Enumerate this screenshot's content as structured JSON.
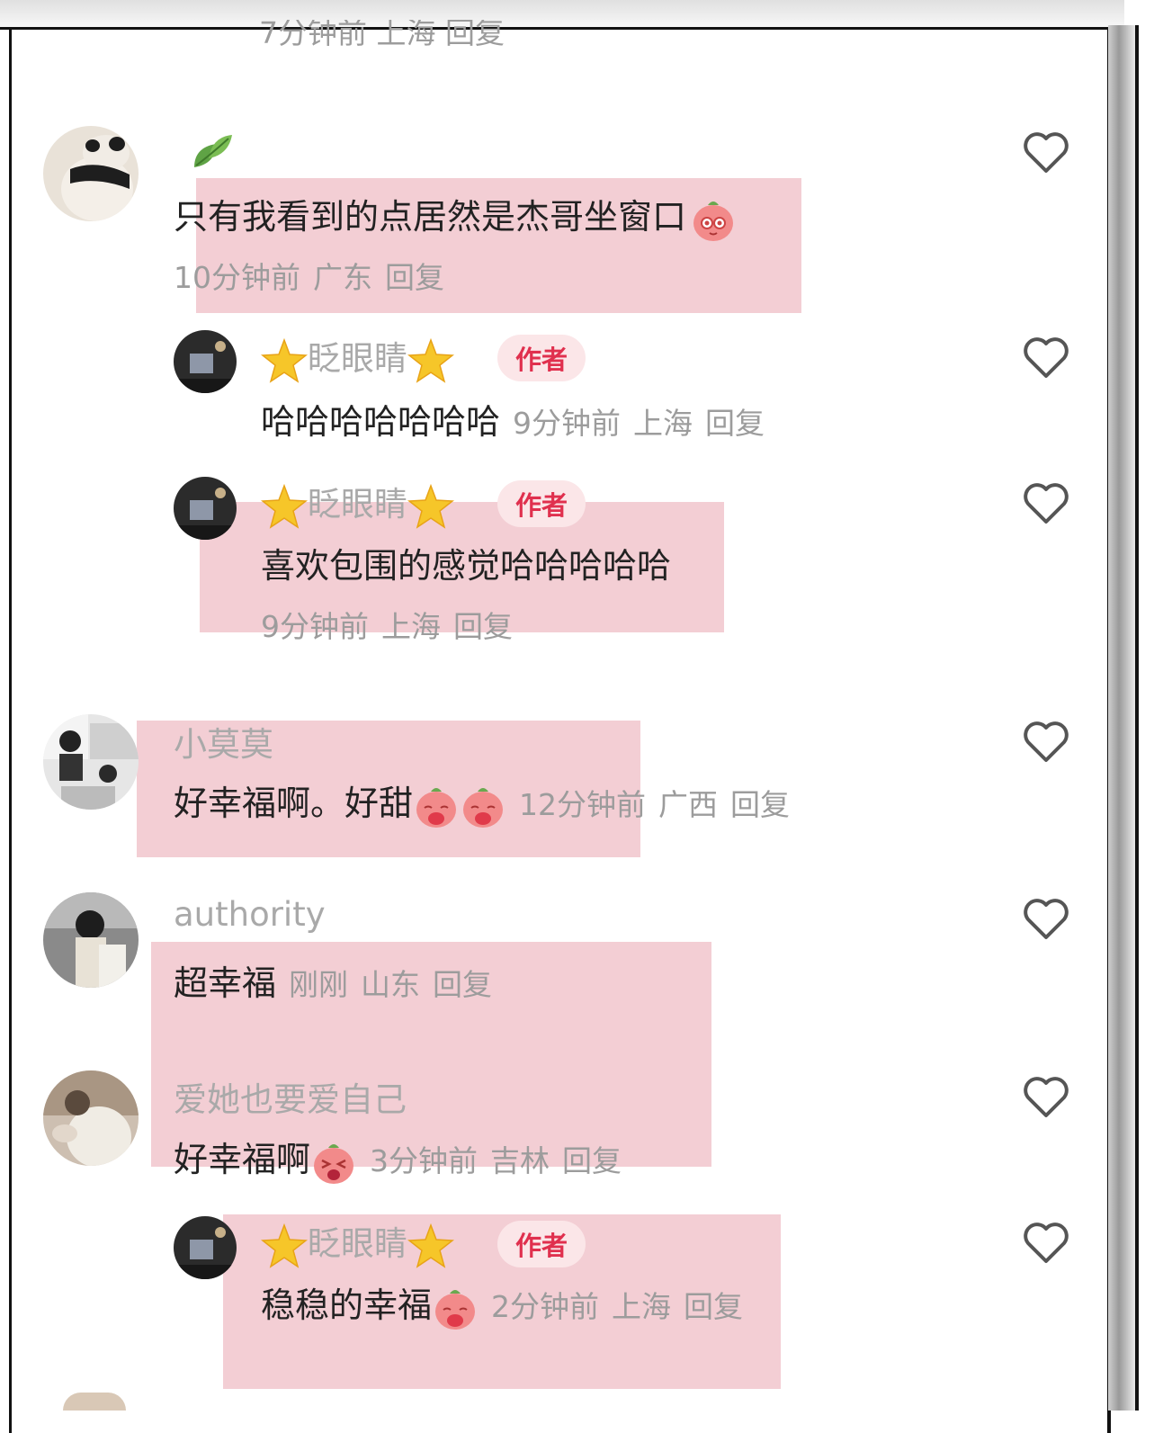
{
  "top_partial_meta": "7分钟前 上海 回复",
  "author_badge": "作者",
  "comments": [
    {
      "name": "",
      "text": "只有我看到的点居然是杰哥坐窗口",
      "time": "10分钟前",
      "location": "广东",
      "reply": "回复",
      "avatar": "panda-avatar"
    },
    {
      "name": "眨眼睛",
      "text": "哈哈哈哈哈哈哈",
      "time": "9分钟前",
      "location": "上海",
      "reply": "回复",
      "is_author": true
    },
    {
      "name": "眨眼睛",
      "text": "喜欢包围的感觉哈哈哈哈哈",
      "time": "9分钟前",
      "location": "上海",
      "reply": "回复",
      "is_author": true
    },
    {
      "name": "小莫莫",
      "text": "好幸福啊。好甜",
      "time": "12分钟前",
      "location": "广西",
      "reply": "回复"
    },
    {
      "name": "authority",
      "text": "超幸福",
      "time": "刚刚",
      "location": "山东",
      "reply": "回复"
    },
    {
      "name": "爱她也要爱自己",
      "text": "好幸福啊",
      "time": "3分钟前",
      "location": "吉林",
      "reply": "回复"
    },
    {
      "name": "眨眼睛",
      "text": "稳稳的幸福",
      "time": "2分钟前",
      "location": "上海",
      "reply": "回复",
      "is_author": true
    }
  ],
  "colors": {
    "highlight": "#ecb0b9",
    "author_badge_text": "#e0304e",
    "author_badge_bg": "#fbe6e8",
    "meta_gray": "#9c9c9c"
  }
}
